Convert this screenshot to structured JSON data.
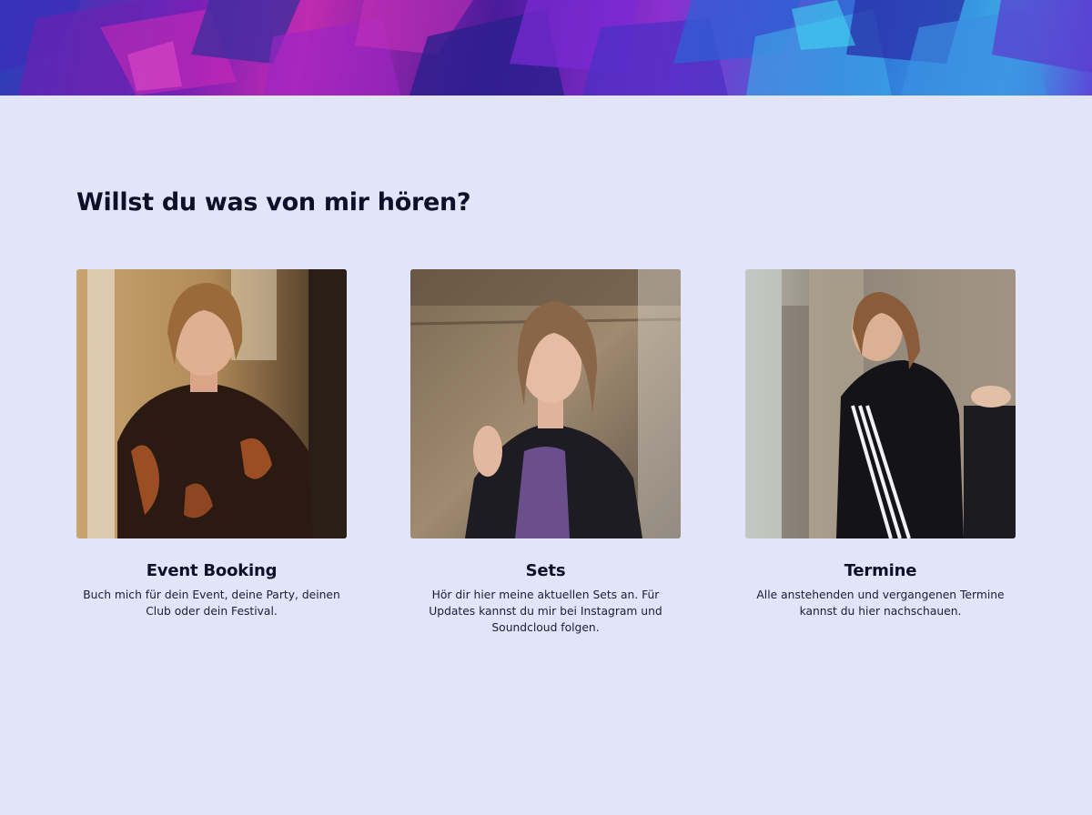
{
  "section": {
    "title": "Willst du was von mir hören?"
  },
  "cards": [
    {
      "title": "Event Booking",
      "text": "Buch mich für dein Event, deine Party, deinen Club oder dein Festival.",
      "image_icon": "portrait-photo"
    },
    {
      "title": "Sets",
      "text": "Hör dir hier meine aktuellen Sets an. Für Updates kannst du mir bei Instagram und Soundcloud folgen.",
      "image_icon": "portrait-photo"
    },
    {
      "title": "Termine",
      "text": "Alle anstehenden und vergangenen Termine kannst du hier nachschauen.",
      "image_icon": "portrait-photo"
    }
  ],
  "colors": {
    "background": "#e2e4f9",
    "text": "#0d0f2b"
  }
}
